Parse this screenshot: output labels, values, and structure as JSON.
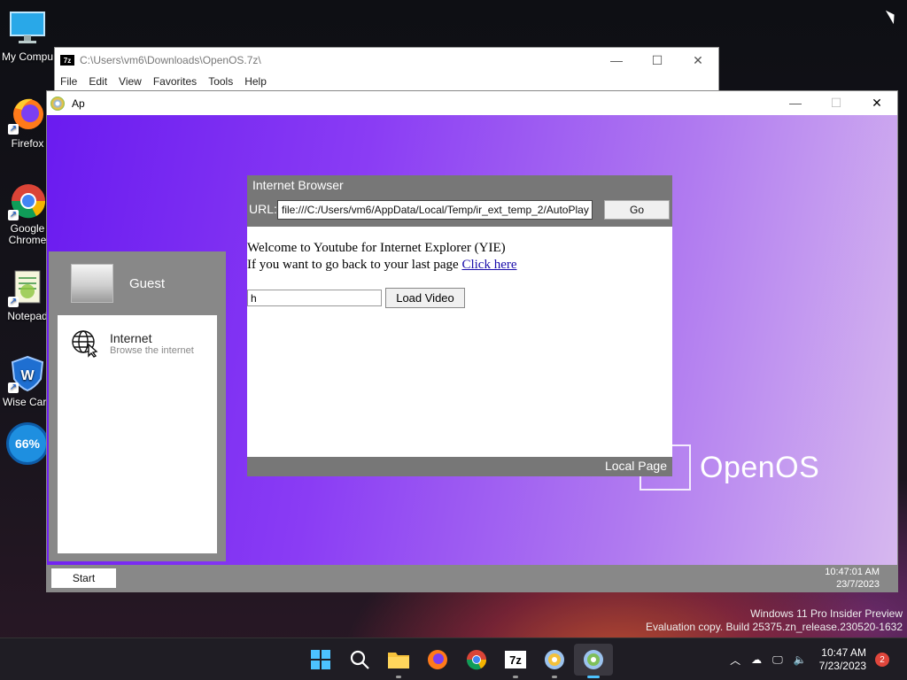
{
  "desktop": {
    "icons": [
      {
        "label": "My Compu",
        "icon": "computer-icon"
      },
      {
        "label": "Firefox",
        "icon": "firefox-icon"
      },
      {
        "label": "Google Chrome",
        "icon": "chrome-icon"
      },
      {
        "label": "Notepad",
        "icon": "notepad-icon"
      },
      {
        "label": "Wise Care",
        "icon": "wise-care-icon"
      }
    ],
    "badge_percent": "66%"
  },
  "sevenzip_window": {
    "title": "C:\\Users\\vm6\\Downloads\\OpenOS.7z\\",
    "app_icon_text": "7z",
    "menu": [
      "File",
      "Edit",
      "View",
      "Favorites",
      "Tools",
      "Help"
    ]
  },
  "ap_window": {
    "title": "Ap"
  },
  "openos": {
    "logo_text": "OpenOS",
    "start_menu": {
      "username": "Guest",
      "apps": [
        {
          "title": "Internet",
          "subtitle": "Browse the internet",
          "icon": "globe-cursor-icon"
        }
      ]
    },
    "browser": {
      "title": "Internet Browser",
      "url_label": "URL:",
      "url_value": "file:///C:/Users/vm6/AppData/Local/Temp/ir_ext_temp_2/AutoPlay",
      "go_label": "Go",
      "content": {
        "welcome": "Welcome to Youtube for Internet Explorer (YIE)",
        "back_text": "If you want to go back to your last page",
        "back_link": "Click here",
        "video_input_value": "h",
        "load_button": "Load Video"
      },
      "footer": "Local Page"
    },
    "taskbar": {
      "start_label": "Start",
      "time": "10:47:01 AM",
      "date": "23/7/2023"
    }
  },
  "watermark": {
    "line1": "Windows 11 Pro Insider Preview",
    "line2": "Evaluation copy. Build 25375.zn_release.230520-1632"
  },
  "win_taskbar": {
    "apps": [
      "start-icon",
      "search-icon",
      "file-explorer-icon",
      "firefox-icon",
      "chrome-icon",
      "7zip-icon",
      "disc-app-icon",
      "disc-app-active-icon"
    ],
    "sevenzip_text": "7z",
    "clock_time": "10:47 AM",
    "clock_date": "7/23/2023",
    "notifications": "2"
  }
}
